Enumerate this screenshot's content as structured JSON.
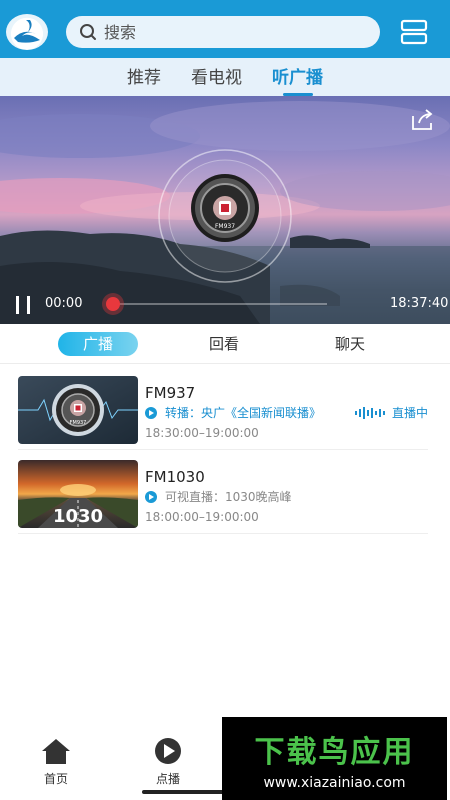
{
  "header": {
    "search_placeholder": "搜索"
  },
  "main_tabs": [
    {
      "label": "推荐",
      "active": false
    },
    {
      "label": "看电视",
      "active": false
    },
    {
      "label": "听广播",
      "active": true
    }
  ],
  "player": {
    "current_time": "00:00",
    "end_time": "18:37:40",
    "progress": 0.0,
    "disc_label": "FM937"
  },
  "sub_tabs": [
    {
      "label": "广播",
      "active": true
    },
    {
      "label": "回看",
      "active": false
    },
    {
      "label": "聊天",
      "active": false
    }
  ],
  "stations": [
    {
      "name": "FM937",
      "program": "转播：央广《全国新闻联播》",
      "time": "18:30:00–19:00:00",
      "status": "直播中",
      "thumb_label": "FM937"
    },
    {
      "name": "FM1030",
      "program": "可视直播：1030晚高峰",
      "time": "18:00:00–19:00:00",
      "status": "",
      "thumb_label": "1030"
    }
  ],
  "bottom_nav": [
    {
      "label": "首页",
      "icon": "home-icon"
    },
    {
      "label": "点播",
      "icon": "play-circle-icon"
    }
  ],
  "watermark": {
    "title": "下载鸟应用",
    "url": "www.xiazainiao.com"
  },
  "colors": {
    "brand_blue": "#1a9ad6",
    "active_tab": "#1a8fd0",
    "progress_knob": "#e8383d",
    "watermark_green": "#4bc24b"
  }
}
